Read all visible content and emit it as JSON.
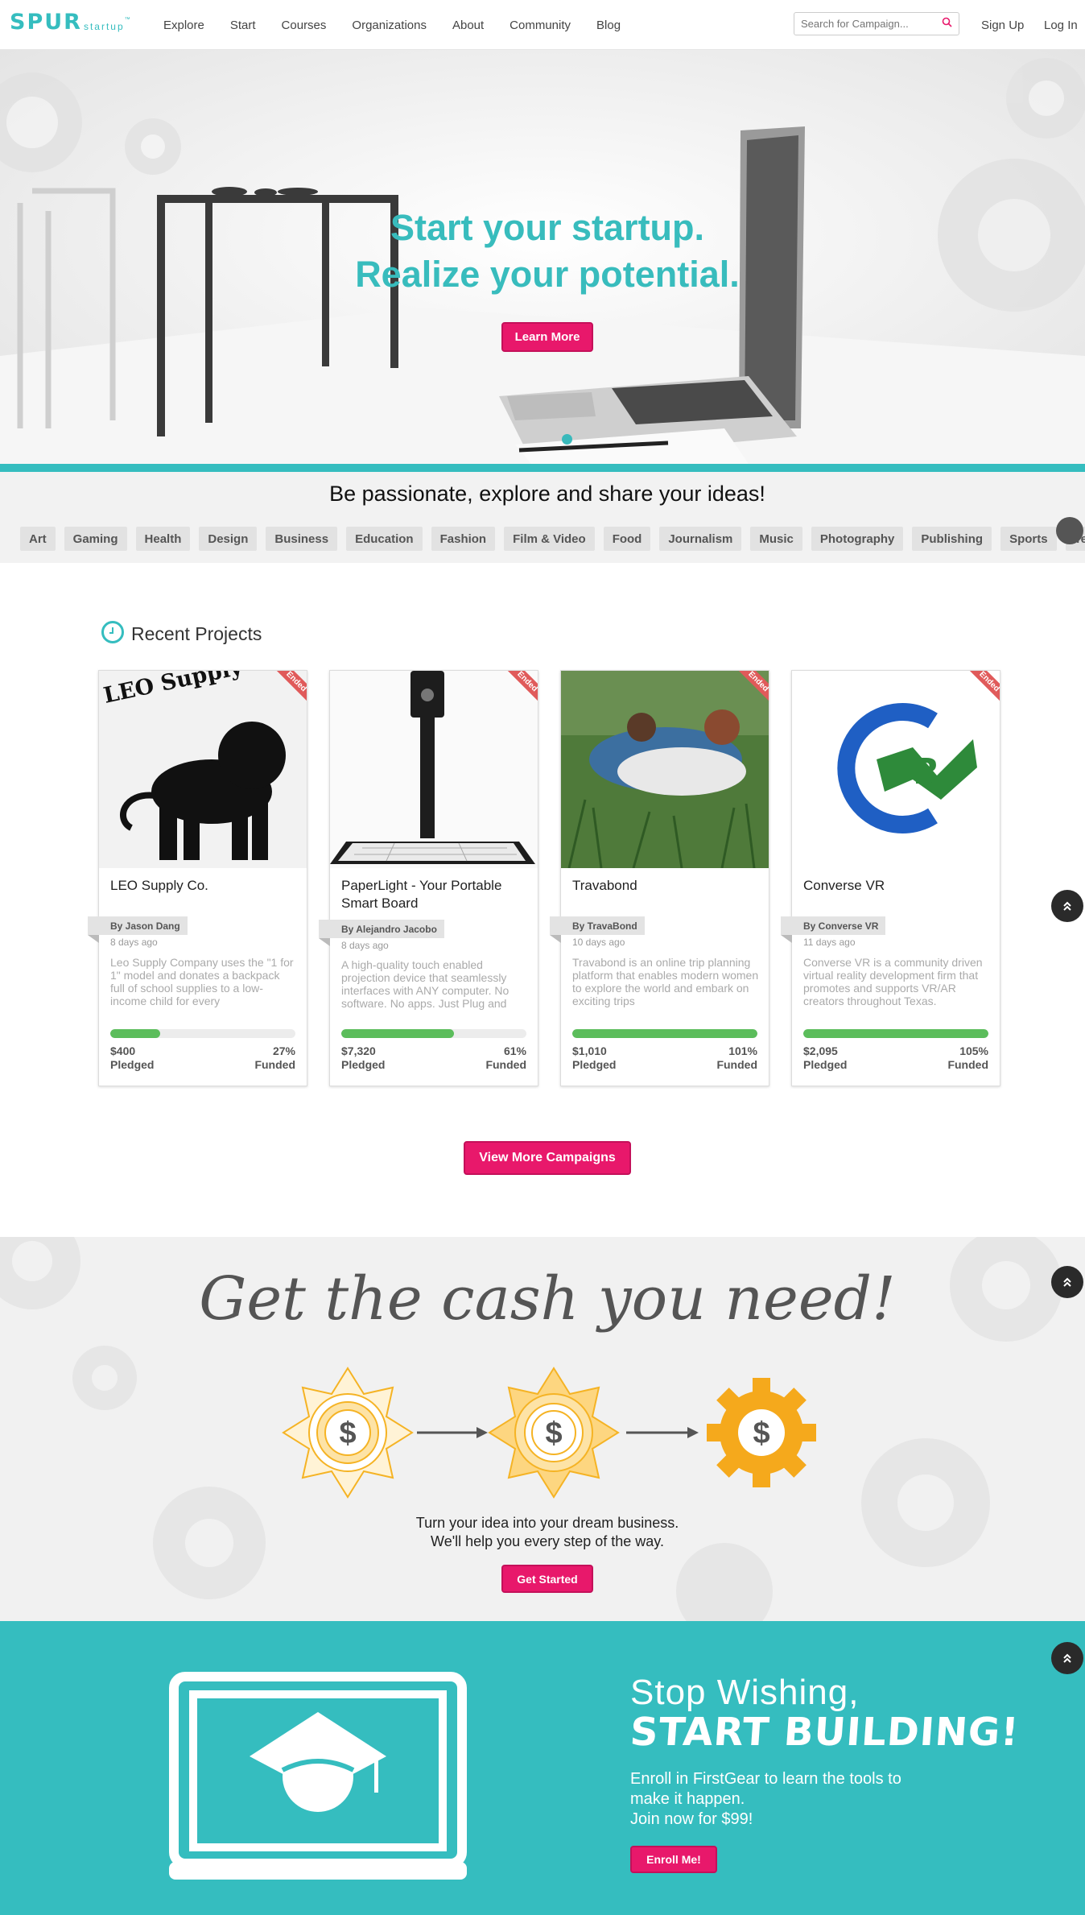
{
  "logo": {
    "main": "SPUR",
    "sub": "startup",
    "tm": "™"
  },
  "nav": {
    "links": [
      "Explore",
      "Start",
      "Courses",
      "Organizations",
      "About",
      "Community",
      "Blog"
    ],
    "search_placeholder": "Search for Campaign...",
    "signup": "Sign Up",
    "login": "Log In"
  },
  "hero": {
    "line1": "Start your startup.",
    "line2": "Realize your potential.",
    "button": "Learn More"
  },
  "categories": {
    "title": "Be passionate, explore and share your ideas!",
    "items": [
      "Art",
      "Gaming",
      "Health",
      "Design",
      "Business",
      "Education",
      "Fashion",
      "Film & Video",
      "Food",
      "Journalism",
      "Music",
      "Photography",
      "Publishing",
      "Sports",
      "Technology"
    ]
  },
  "recent": {
    "title": "Recent Projects",
    "ended_label": "Ended",
    "pledged_label": "Pledged",
    "funded_label": "Funded",
    "cards": [
      {
        "title": "LEO Supply Co.",
        "image_text": "LEO Supply Company",
        "by": "By Jason Dang",
        "date": "8 days ago",
        "desc": "Leo Supply Company uses the \"1 for 1\" model and donates a backpack full of school supplies to a low-income child for every",
        "pledged": "$400",
        "funded": "27%",
        "progress": 0.27
      },
      {
        "title": "PaperLight - Your Portable Smart Board",
        "by": "By Alejandro Jacobo",
        "date": "8 days ago",
        "desc": "A high-quality touch enabled projection device that seamlessly interfaces with ANY computer. No software. No apps. Just Plug and",
        "pledged": "$7,320",
        "funded": "61%",
        "progress": 0.61
      },
      {
        "title": "Travabond",
        "by": "By TravaBond",
        "date": "10 days ago",
        "desc": "Travabond is an online trip planning platform that enables modern women to explore the world and embark on exciting trips",
        "pledged": "$1,010",
        "funded": "101%",
        "progress": 1.0
      },
      {
        "title": "Converse VR",
        "by": "By Converse VR",
        "date": "11 days ago",
        "desc": "Converse VR is a community driven virtual reality development firm that promotes and supports VR/AR creators throughout Texas.",
        "pledged": "$2,095",
        "funded": "105%",
        "progress": 1.0
      }
    ],
    "view_more": "View More Campaigns"
  },
  "cash": {
    "title": "Get the cash you need!",
    "line1": "Turn your idea into your dream business.",
    "line2": "We'll help you every step of the way.",
    "button": "Get Started",
    "coin_symbol": "$"
  },
  "build": {
    "line1": "Stop Wishing,",
    "line2": "START BUILDING!",
    "text1": "Enroll in FirstGear to learn the tools to",
    "text2": "make it happen.",
    "text3": "Join now for $99!",
    "button": "Enroll Me!"
  },
  "colors": {
    "teal": "#35bdbf",
    "pink": "#e8186b",
    "green": "#5bbd5b",
    "gold": "#f5b324"
  },
  "icons": [
    "search-icon",
    "clock-icon",
    "chevron-up-icon",
    "graduation-cap-icon",
    "laptop-icon",
    "dollar-coin-icon",
    "arrow-right-icon",
    "gear-icon"
  ]
}
